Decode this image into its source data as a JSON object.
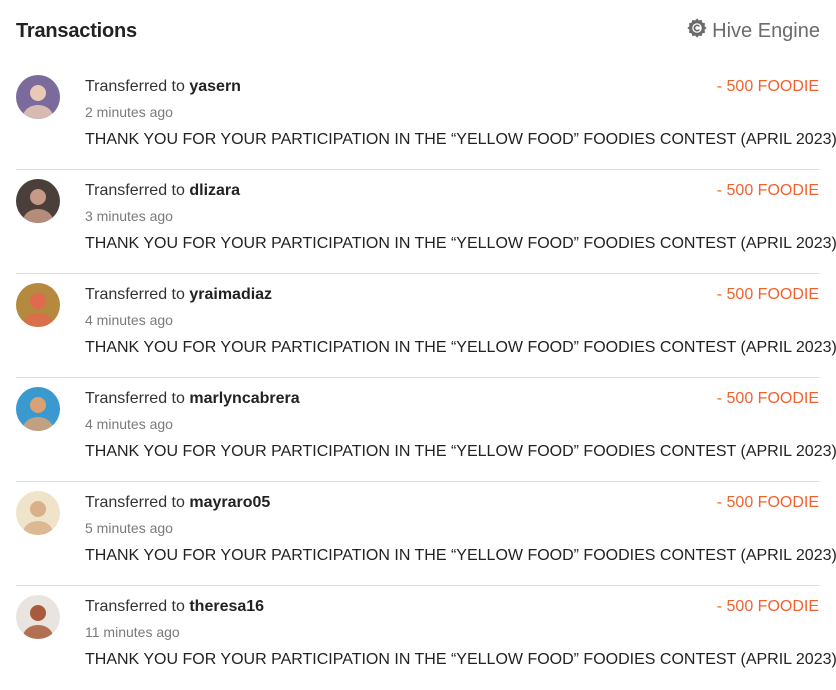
{
  "header": {
    "title": "Transactions",
    "brand_label": "Hive Engine",
    "brand_icon": "hive-engine-gear-icon"
  },
  "transactions": [
    {
      "prefix": "Transferred to",
      "user": "yasern",
      "time": "2 minutes ago",
      "amount": "- 500 FOODIE",
      "memo": "THANK YOU FOR YOUR PARTICIPATION IN THE “YELLOW FOOD” FOODIES CONTEST (APRIL 2023)",
      "avatar_bg": "#7b6a9c",
      "avatar_fg": "#e8c9b5"
    },
    {
      "prefix": "Transferred to",
      "user": "dlizara",
      "time": "3 minutes ago",
      "amount": "- 500 FOODIE",
      "memo": "THANK YOU FOR YOUR PARTICIPATION IN THE “YELLOW FOOD” FOODIES CONTEST (APRIL 2023)",
      "avatar_bg": "#4a3f3a",
      "avatar_fg": "#c79a86"
    },
    {
      "prefix": "Transferred to",
      "user": "yraimadiaz",
      "time": "4 minutes ago",
      "amount": "- 500 FOODIE",
      "memo": "THANK YOU FOR YOUR PARTICIPATION IN THE “YELLOW FOOD” FOODIES CONTEST (APRIL 2023)",
      "avatar_bg": "#b58a3e",
      "avatar_fg": "#e06a4e"
    },
    {
      "prefix": "Transferred to",
      "user": "marlyncabrera",
      "time": "4 minutes ago",
      "amount": "- 500 FOODIE",
      "memo": "THANK YOU FOR YOUR PARTICIPATION IN THE “YELLOW FOOD” FOODIES CONTEST (APRIL 2023)",
      "avatar_bg": "#3a9ad0",
      "avatar_fg": "#d9a274"
    },
    {
      "prefix": "Transferred to",
      "user": "mayraro05",
      "time": "5 minutes ago",
      "amount": "- 500 FOODIE",
      "memo": "THANK YOU FOR YOUR PARTICIPATION IN THE “YELLOW FOOD” FOODIES CONTEST (APRIL 2023)",
      "avatar_bg": "#efe3c9",
      "avatar_fg": "#d8b08a"
    },
    {
      "prefix": "Transferred to",
      "user": "theresa16",
      "time": "11 minutes ago",
      "amount": "- 500 FOODIE",
      "memo": "THANK YOU FOR YOUR PARTICIPATION IN THE “YELLOW FOOD” FOODIES CONTEST (APRIL 2023)",
      "avatar_bg": "#e9e4df",
      "avatar_fg": "#a85a3a"
    }
  ]
}
